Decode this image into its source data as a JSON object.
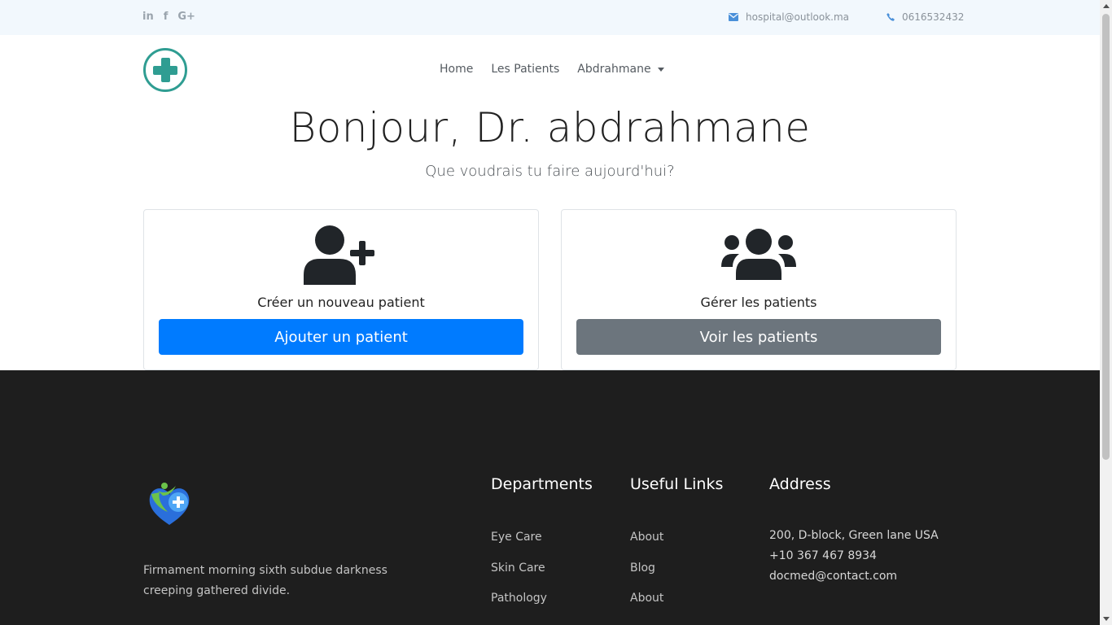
{
  "topbar": {
    "social": [
      {
        "label": "in",
        "icon": "linkedin-icon"
      },
      {
        "label": "f",
        "icon": "facebook-icon"
      },
      {
        "label": "G+",
        "icon": "google-plus-icon"
      }
    ],
    "email": "hospital@outlook.ma",
    "phone": "0616532432",
    "accent_color": "#4a90d9"
  },
  "navbar": {
    "logo_icon": "medical-cross-icon",
    "items": [
      "Home",
      "Les Patients"
    ],
    "user_dropdown": "Abdrahmane"
  },
  "hero": {
    "title": "Bonjour, Dr. abdrahmane",
    "subtitle": "Que voudrais tu faire aujourd'hui?"
  },
  "cards": [
    {
      "icon": "user-plus-icon",
      "title": "Créer un nouveau patient",
      "button": "Ajouter un patient",
      "button_color": "#007bff"
    },
    {
      "icon": "users-icon",
      "title": "Gérer les patients",
      "button": "Voir les patients",
      "button_color": "#6c757d"
    }
  ],
  "footer": {
    "logo_icon": "heart-health-logo-icon",
    "description": "Firmament morning sixth subdue darkness creeping gathered divide.",
    "departments": {
      "title": "Departments",
      "items": [
        "Eye Care",
        "Skin Care",
        "Pathology"
      ]
    },
    "useful_links": {
      "title": "Useful Links",
      "items": [
        "About",
        "Blog",
        "About"
      ]
    },
    "address": {
      "title": "Address",
      "lines": [
        "200, D-block, Green lane USA",
        "+10 367 467 8934",
        "docmed@contact.com"
      ]
    },
    "background": "#1e1e1e"
  }
}
